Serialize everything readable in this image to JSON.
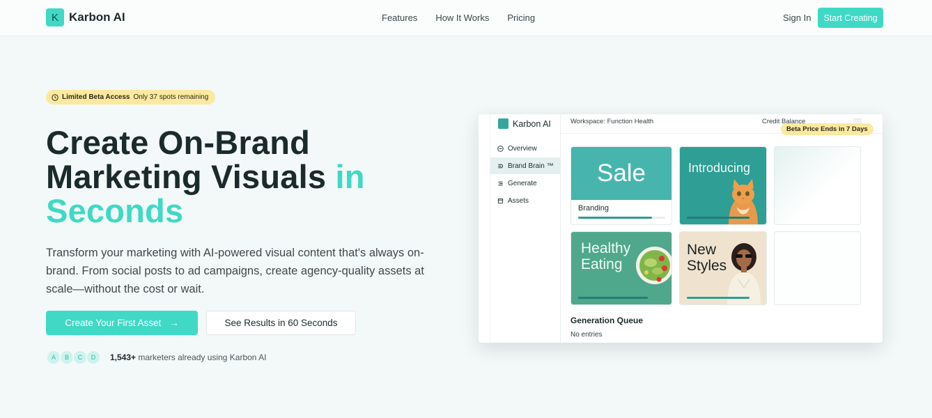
{
  "nav": {
    "brand": "Karbon AI",
    "logo_letter": "K",
    "links": [
      "Features",
      "How It Works",
      "Pricing"
    ],
    "signin": "Sign In",
    "cta": "Start Creating"
  },
  "hero": {
    "badge_strong": "Limited Beta Access",
    "badge_rest": "Only 37 spots remaining",
    "title_line1": "Create On-Brand",
    "title_line2": "Marketing Visuals",
    "title_accent_inline": "in",
    "title_accent_line3": "Seconds",
    "subtitle": "Transform your marketing with AI-powered visual content that's always on-brand. From social posts to ad campaigns, create agency-quality assets at scale—without the cost or wait.",
    "primary_cta": "Create Your First Asset",
    "primary_cta_arrow": "→",
    "secondary_cta": "See Results in 60 Seconds",
    "avatars": [
      "A",
      "B",
      "C",
      "D"
    ],
    "proof_count": "1,543+",
    "proof_text": "marketers already using Karbon AI"
  },
  "dashboard": {
    "brand": "Karbon AI",
    "workspace": "Workspace: Function Health",
    "credit": "Credit Balance",
    "beta_price": "Beta Price Ends in 7 Days",
    "nav": [
      {
        "label": "Overview",
        "icon": "circle-minus-icon",
        "active": false
      },
      {
        "label": "Brand Brain ™",
        "icon": "brain-icon",
        "active": true
      },
      {
        "label": "Generate",
        "icon": "lines-icon",
        "active": false
      },
      {
        "label": "Assets",
        "icon": "folder-icon",
        "active": false
      }
    ],
    "cards": {
      "sale": {
        "headline": "Sale",
        "label": "Branding",
        "progress": 0.85
      },
      "intro": {
        "headline": "Introducing",
        "progress": 1.0
      },
      "healthy": {
        "line1": "Healthy",
        "line2": "Eating",
        "progress": 1.0
      },
      "styles": {
        "line1": "New",
        "line2": "Styles",
        "progress": 1.0
      }
    },
    "queue_title": "Generation Queue",
    "queue_empty": "No entries"
  },
  "colors": {
    "accent": "#3fd9c6",
    "teal_dark": "#2f9e94",
    "badge": "#fbe9a0",
    "text": "#1b2a2a"
  }
}
